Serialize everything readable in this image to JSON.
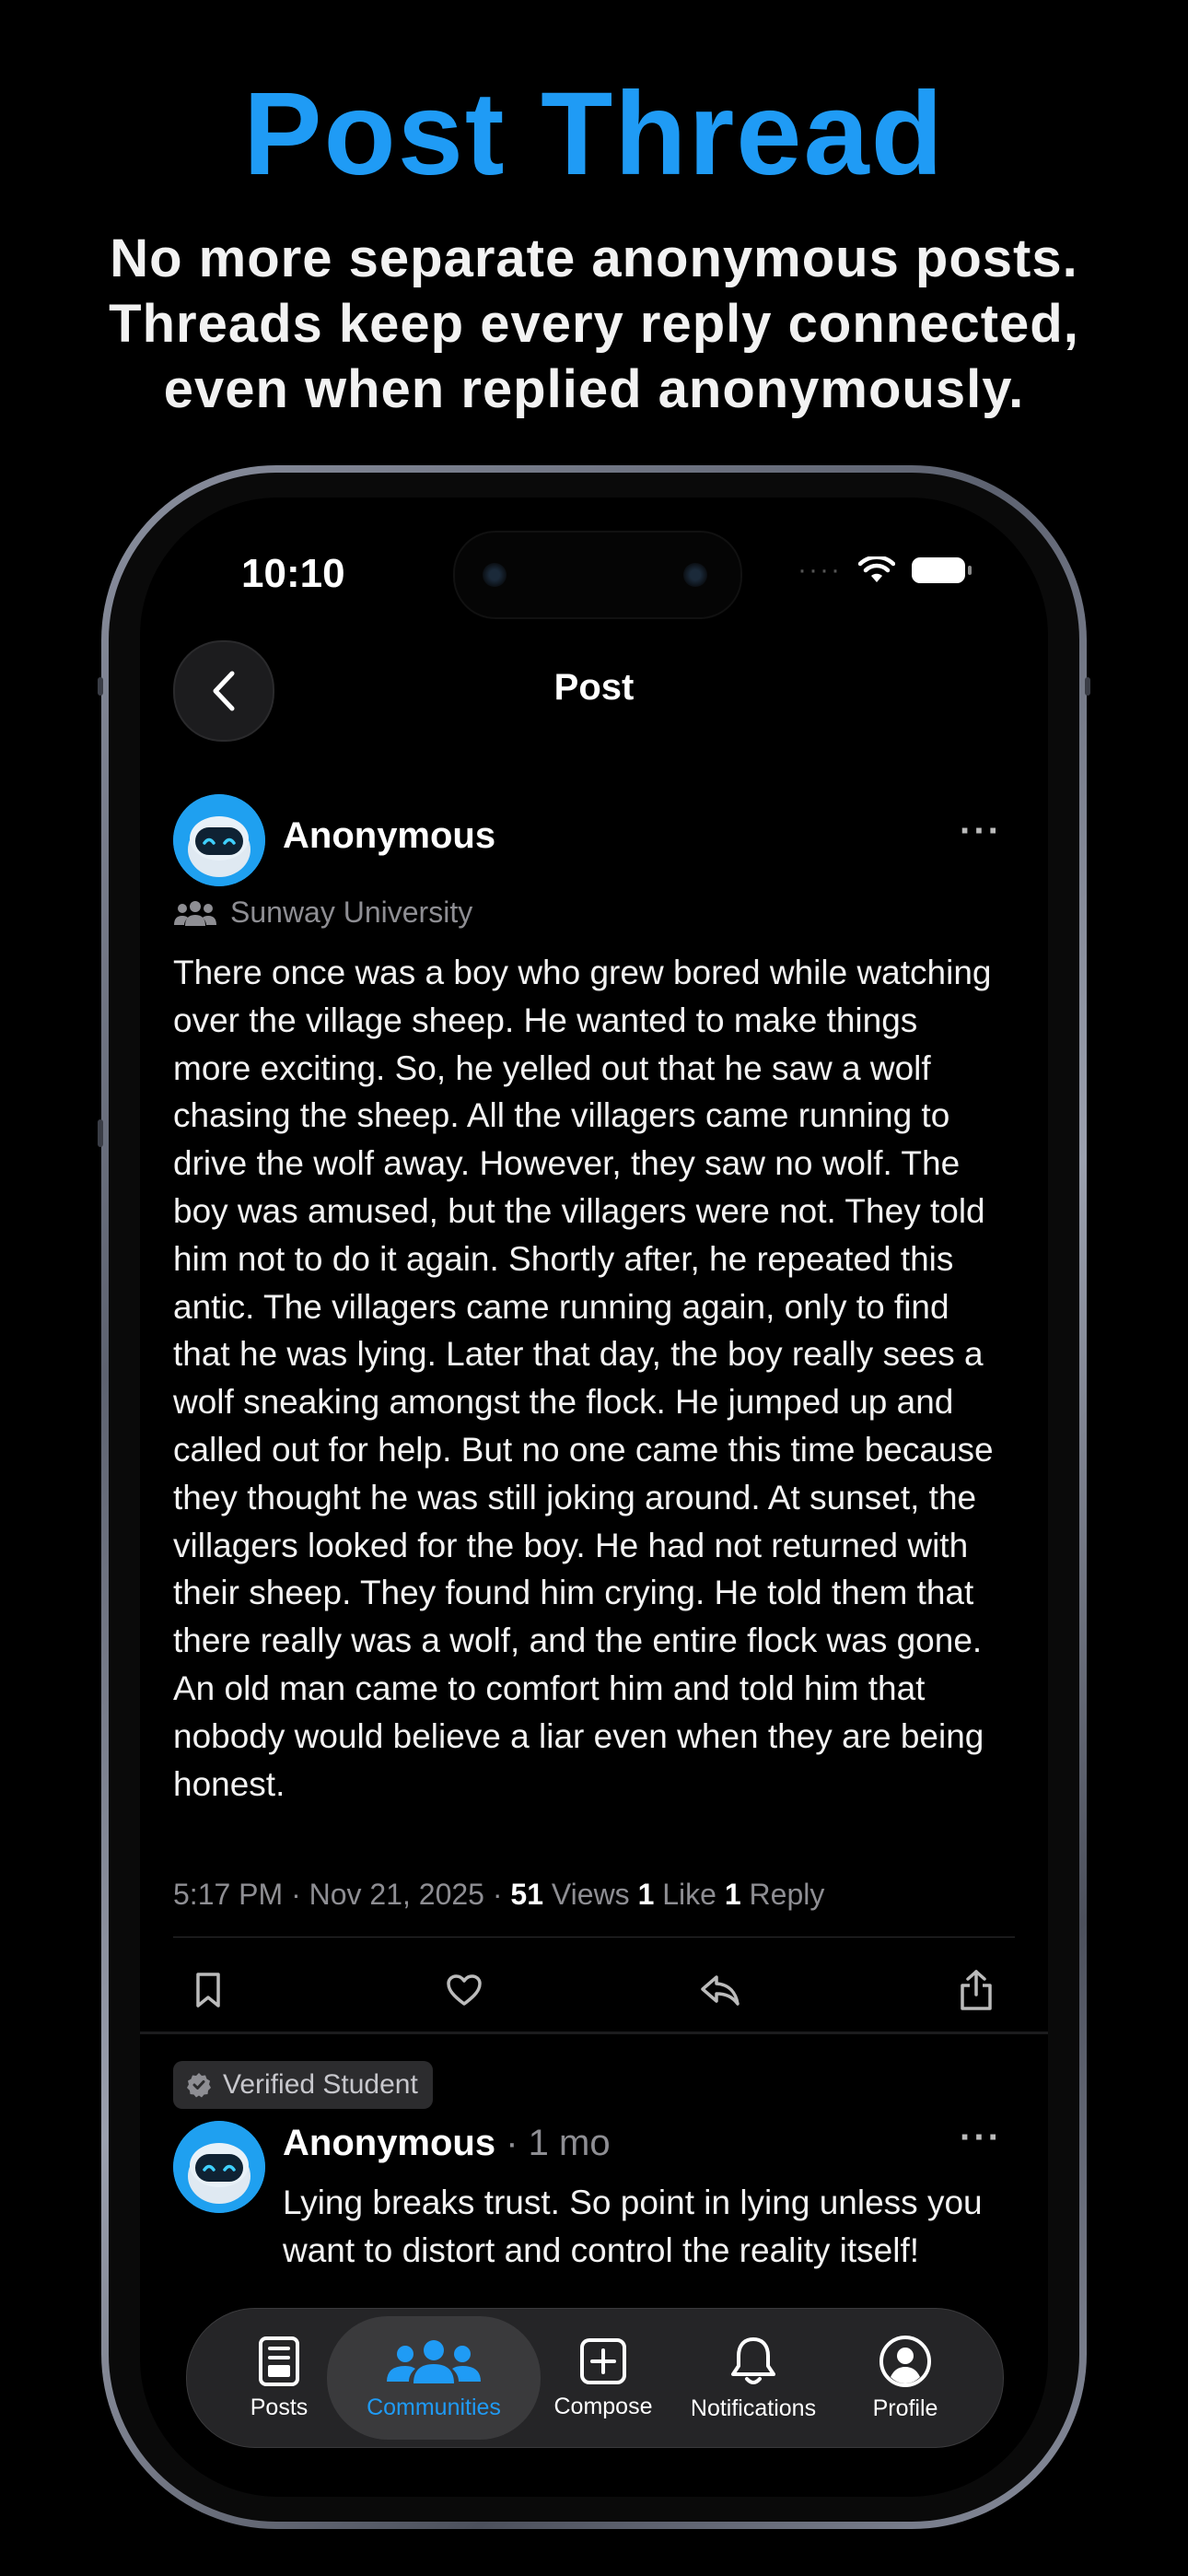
{
  "promo": {
    "title": "Post Thread",
    "subtitle": "No more separate anonymous posts. Threads keep every reply connected, even when replied anonymously."
  },
  "status_bar": {
    "time": "10:10"
  },
  "nav": {
    "title": "Post"
  },
  "post": {
    "author": "Anonymous",
    "more": "···",
    "community": "Sunway University",
    "body": "There once was a boy who grew bored while watching over the village sheep. He wanted to make things more exciting. So, he yelled out that he saw a wolf chasing the sheep. All the villagers came running to drive the wolf away. However, they saw no wolf. The boy was amused, but the villagers were not. They told him not to do it again. Shortly after, he repeated this antic. The villagers came running again, only to find that he was lying. Later that day, the boy really sees a wolf sneaking amongst the flock. He jumped up and called out for help. But no one came this time because they thought he was still joking around. At sunset, the villagers looked for the boy. He had not returned with their sheep. They found him crying. He told them that there really was a wolf, and the entire flock was gone. An old man came to comfort him and told him that nobody would believe a liar even when they are being honest.",
    "timestamp": "5:17 PM · Nov 21, 2025 ·",
    "views_count": "51",
    "views_label": "Views",
    "likes_count": "1",
    "likes_label": "Like",
    "replies_count": "1",
    "replies_label": "Reply"
  },
  "actions": {
    "bookmark": "bookmark-icon",
    "like": "heart-icon",
    "reply": "reply-icon",
    "share": "share-icon"
  },
  "reply": {
    "badge": "Verified Student",
    "author": "Anonymous",
    "time": "· 1 mo",
    "more": "···",
    "body": "Lying breaks trust. So point in lying unless you want to distort and control the reality itself!"
  },
  "tabbar": {
    "tabs": [
      {
        "label": "Posts",
        "icon": "posts-icon"
      },
      {
        "label": "Communities",
        "icon": "communities-icon",
        "active": true
      },
      {
        "label": "Compose",
        "icon": "compose-icon"
      },
      {
        "label": "Notifications",
        "icon": "bell-icon"
      },
      {
        "label": "Profile",
        "icon": "profile-icon"
      }
    ]
  },
  "colors": {
    "accent": "#1f9bf5",
    "background": "#000000",
    "muted": "#8e8e93"
  }
}
